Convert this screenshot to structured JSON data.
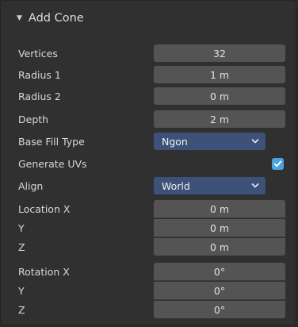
{
  "panel": {
    "title": "Add Cone",
    "vertices": {
      "label": "Vertices",
      "value": "32"
    },
    "radius1": {
      "label": "Radius 1",
      "value": "1 m"
    },
    "radius2": {
      "label": "Radius 2",
      "value": "0 m"
    },
    "depth": {
      "label": "Depth",
      "value": "2 m"
    },
    "base_fill_type": {
      "label": "Base Fill Type",
      "value": "Ngon"
    },
    "generate_uvs": {
      "label": "Generate UVs",
      "checked": true
    },
    "align": {
      "label": "Align",
      "value": "World"
    },
    "location": {
      "x": {
        "label": "Location X",
        "value": "0 m"
      },
      "y": {
        "label": "Y",
        "value": "0 m"
      },
      "z": {
        "label": "Z",
        "value": "0 m"
      }
    },
    "rotation": {
      "x": {
        "label": "Rotation X",
        "value": "0°"
      },
      "y": {
        "label": "Y",
        "value": "0°"
      },
      "z": {
        "label": "Z",
        "value": "0°"
      }
    }
  },
  "colors": {
    "panel_bg": "#303030",
    "field_bg": "#545454",
    "dropdown_bg": "#3e5279",
    "checkbox_accent": "#4aa3df"
  },
  "icons": {
    "collapse": "triangle-down-icon",
    "dropdown": "chevron-down-icon",
    "check": "checkmark-icon"
  }
}
